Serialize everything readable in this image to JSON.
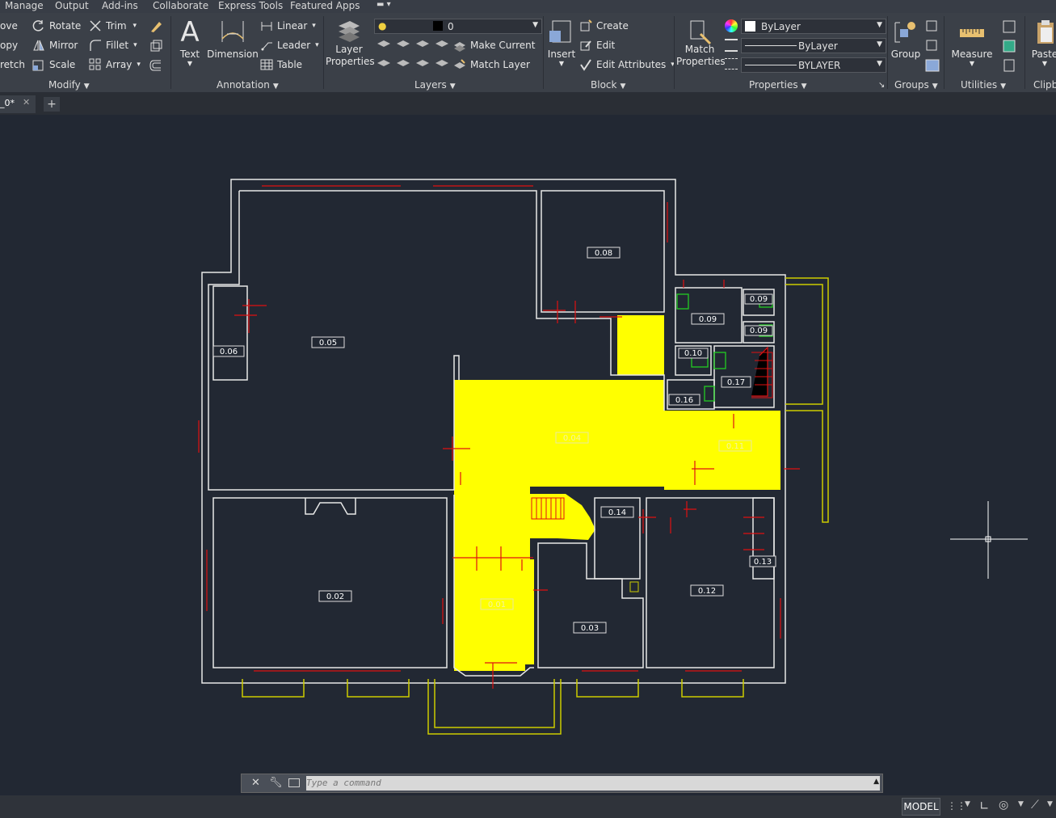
{
  "menu": {
    "items": [
      "Manage",
      "Output",
      "Add-ins",
      "Collaborate",
      "Express Tools",
      "Featured Apps"
    ]
  },
  "ribbon": {
    "modify": {
      "title": "Modify",
      "tools": {
        "move": "ove",
        "copy": "opy",
        "stretch": "retch",
        "rotate": "Rotate",
        "mirror": "Mirror",
        "scale": "Scale",
        "trim": "Trim",
        "fillet": "Fillet",
        "array": "Array"
      }
    },
    "annotation": {
      "title": "Annotation",
      "text": "Text",
      "dimension": "Dimension",
      "linear": "Linear",
      "leader": "Leader",
      "table": "Table"
    },
    "layers": {
      "title": "Layers",
      "layer_properties": "Layer\nProperties",
      "current_layer": "0",
      "make_current": "Make Current",
      "match_layer": "Match Layer"
    },
    "block": {
      "title": "Block",
      "insert": "Insert",
      "create": "Create",
      "edit": "Edit",
      "edit_attributes": "Edit Attributes"
    },
    "properties": {
      "title": "Properties",
      "match_properties": "Match\nProperties",
      "color": "ByLayer",
      "linetype": "ByLayer",
      "lineweight": "BYLAYER"
    },
    "groups": {
      "title": "Groups",
      "group": "Group"
    },
    "utilities": {
      "title": "Utilities",
      "measure": "Measure"
    },
    "clipboard": {
      "title": "Clipb",
      "paste": "Paste"
    }
  },
  "tabs": {
    "drawing_tab": "_0*"
  },
  "drawing": {
    "room_labels": [
      "0.01",
      "0.02",
      "0.03",
      "0.05",
      "0.06",
      "0.08",
      "0.09",
      "0.09a",
      "0.09b",
      "0.10",
      "0.11",
      "0.12",
      "0.13",
      "0.14",
      "0.16",
      "0.17",
      "0.04"
    ],
    "room_label_text": {
      "r001": "0.01",
      "r002": "0.02",
      "r003": "0.03",
      "r004": "0.04",
      "r005": "0.05",
      "r006": "0.06",
      "r008": "0.08",
      "r009": "0.09",
      "r009a": "0.09",
      "r009b": "0.09",
      "r010": "0.10",
      "r011": "0.11",
      "r012": "0.12",
      "r013": "0.13",
      "r014": "0.14",
      "r016": "0.16",
      "r017": "0.17"
    },
    "colors": {
      "walls": "#e8e8e8",
      "highlight": "#ffff00",
      "markers": "#e01010",
      "fixtures": "#22cc22",
      "outline_yellow": "#cccc00"
    }
  },
  "command": {
    "placeholder": "Type a command"
  },
  "status": {
    "model": "MODEL"
  }
}
